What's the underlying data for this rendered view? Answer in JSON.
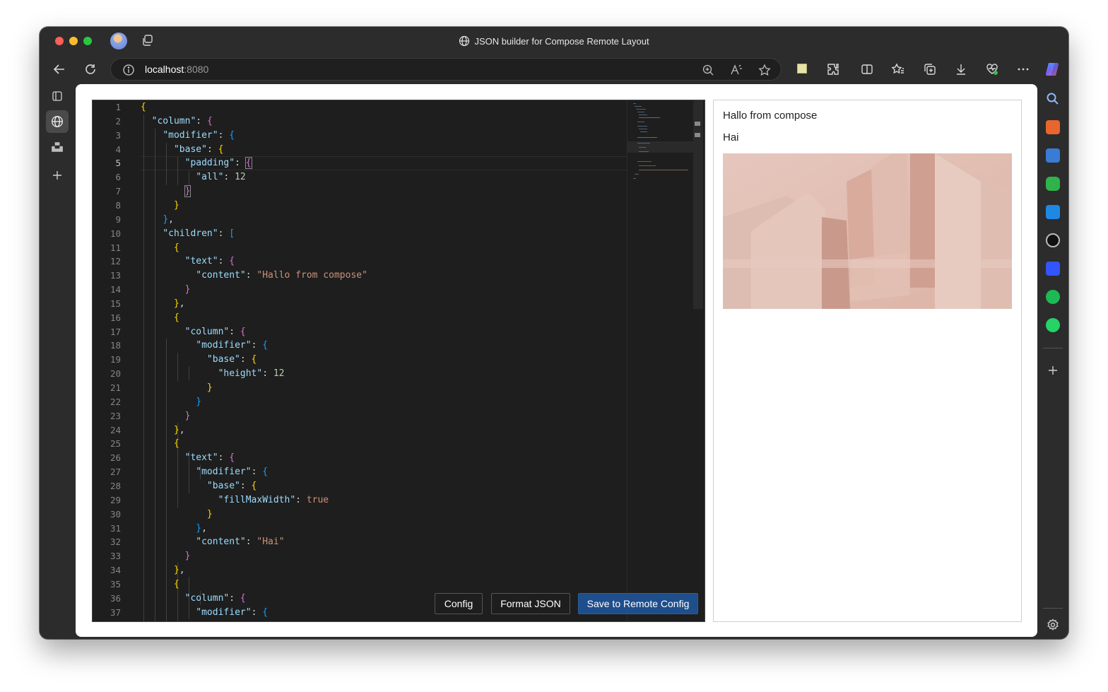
{
  "browser": {
    "window_title": "JSON builder for Compose Remote Layout",
    "url_host": "localhost",
    "url_port": ":8080"
  },
  "editor": {
    "line_numbers": [
      "1",
      "2",
      "3",
      "4",
      "5",
      "6",
      "7",
      "8",
      "9",
      "10",
      "11",
      "12",
      "13",
      "14",
      "15",
      "16",
      "17",
      "18",
      "19",
      "20",
      "21",
      "22",
      "23",
      "24",
      "25",
      "26",
      "27",
      "28",
      "29",
      "30",
      "31",
      "32",
      "33",
      "34",
      "35",
      "36",
      "37"
    ],
    "current_line": "5"
  },
  "buttons": {
    "config": "Config",
    "format": "Format JSON",
    "save": "Save to Remote Config"
  },
  "preview": {
    "text1": "Hallo from compose",
    "text2": "Hai",
    "image_alt": "abstract pink architecture render"
  },
  "colors": {
    "editor_bg": "#1e1e1e",
    "key": "#9cdcfe",
    "string": "#ce9178",
    "number": "#b5cea8",
    "primary_button": "#1f4e8c"
  }
}
